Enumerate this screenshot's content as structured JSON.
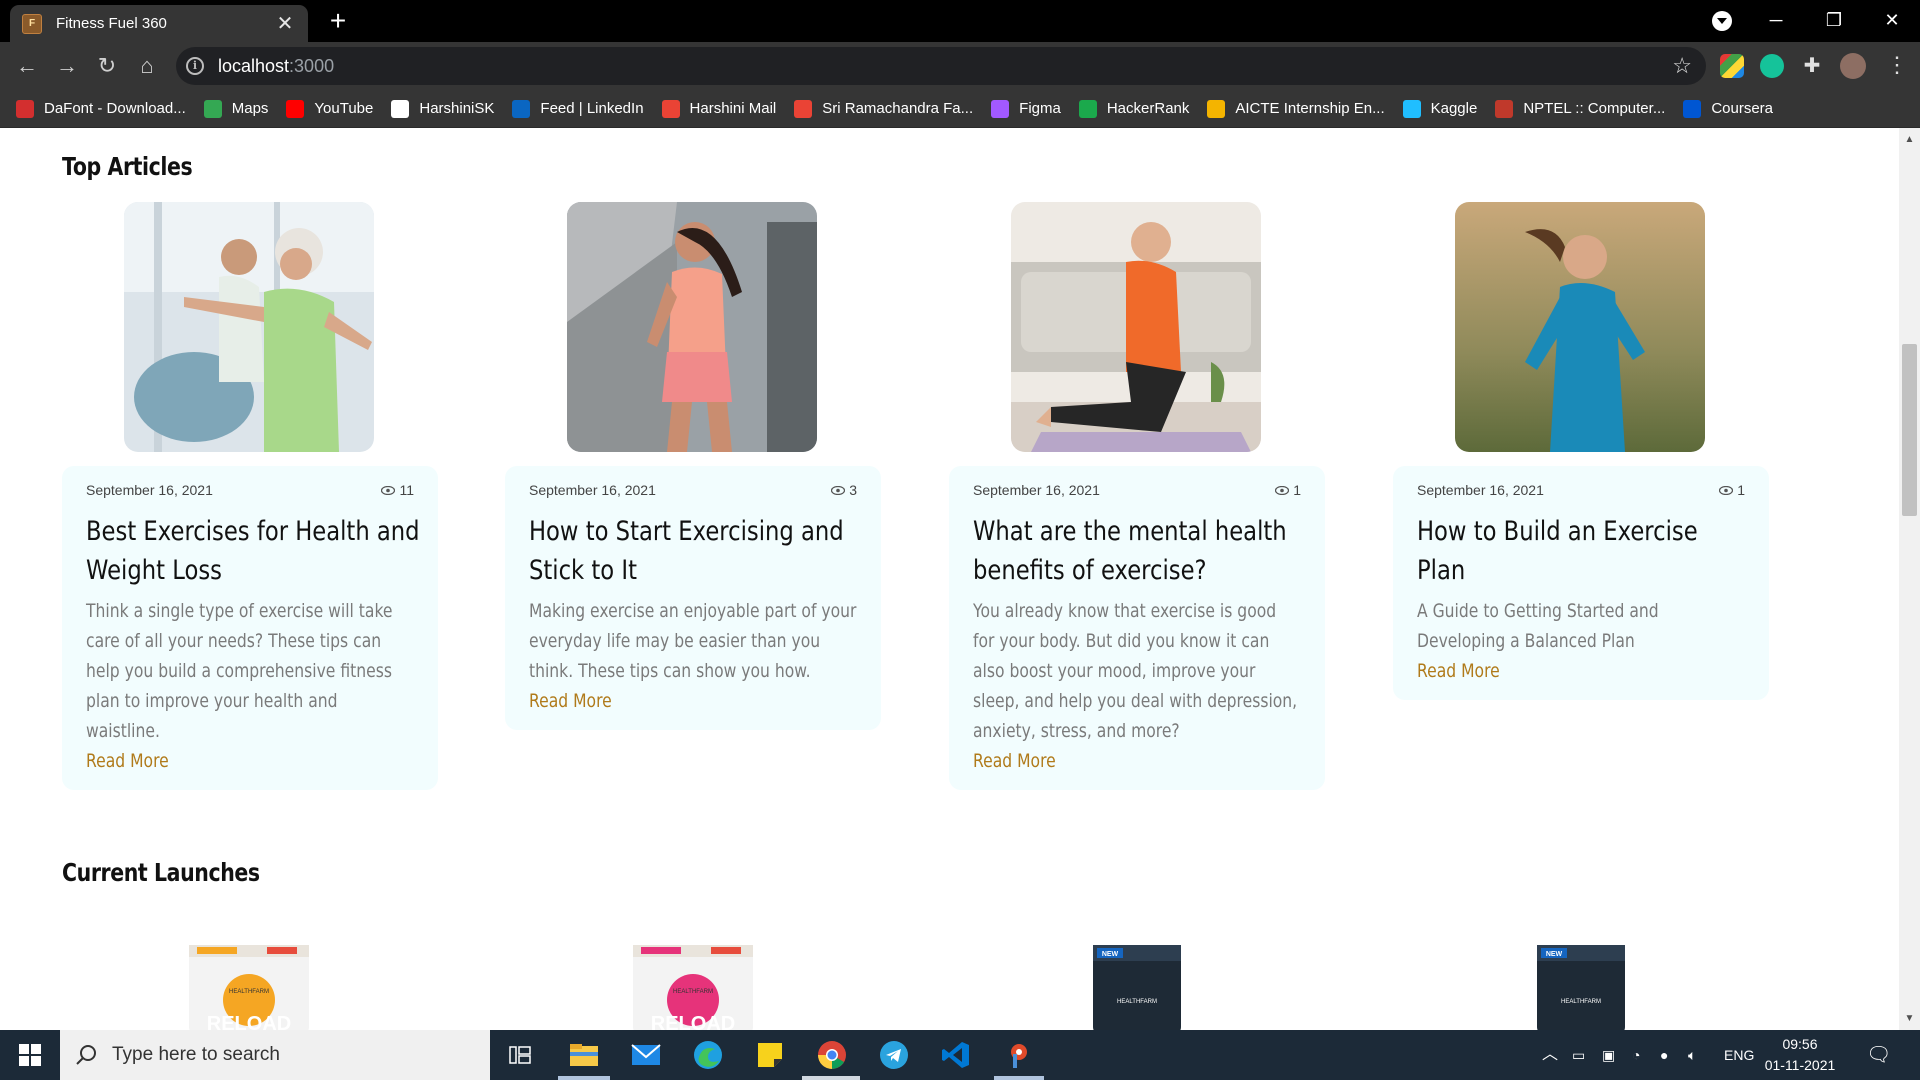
{
  "browser": {
    "tab_title": "Fitness Fuel 360",
    "url_host": "localhost",
    "url_port": ":3000",
    "bookmarks": [
      {
        "label": "DaFont - Download...",
        "icon": "dafont-icon",
        "color": "#d32f2f"
      },
      {
        "label": "Maps",
        "icon": "maps-icon",
        "color": "#34a853"
      },
      {
        "label": "YouTube",
        "icon": "youtube-icon",
        "color": "#ff0000"
      },
      {
        "label": "HarshiniSK",
        "icon": "github-icon",
        "color": "#ffffff"
      },
      {
        "label": "Feed | LinkedIn",
        "icon": "linkedin-icon",
        "color": "#0a66c2"
      },
      {
        "label": "Harshini Mail",
        "icon": "gmail-icon",
        "color": "#ea4335"
      },
      {
        "label": "Sri Ramachandra Fa...",
        "icon": "gmail-icon",
        "color": "#ea4335"
      },
      {
        "label": "Figma",
        "icon": "figma-icon",
        "color": "#a259ff"
      },
      {
        "label": "HackerRank",
        "icon": "hackerrank-icon",
        "color": "#1ba94c"
      },
      {
        "label": "AICTE Internship En...",
        "icon": "aicte-icon",
        "color": "#f4b400"
      },
      {
        "label": "Kaggle",
        "icon": "kaggle-icon",
        "color": "#20beff"
      },
      {
        "label": "NPTEL :: Computer...",
        "icon": "nptel-icon",
        "color": "#c0392b"
      },
      {
        "label": "Coursera",
        "icon": "coursera-icon",
        "color": "#0056d2"
      }
    ]
  },
  "page": {
    "top_articles_title": "Top Articles",
    "current_launches_title": "Current Launches",
    "read_more_label": "Read More",
    "articles": [
      {
        "date": "September 16, 2021",
        "views": "11",
        "title": "Best Exercises for Health and Weight Loss",
        "description": "Think a single type of exercise will take care of all your needs? These tips can help you build a comprehensive fitness plan to improve your health and waistline."
      },
      {
        "date": "September 16, 2021",
        "views": "3",
        "title": "How to Start Exercising and Stick to It",
        "description": "Making exercise an enjoyable part of your everyday life may be easier than you think. These tips can show you how."
      },
      {
        "date": "September 16, 2021",
        "views": "1",
        "title": "What are the mental health benefits of exercise?",
        "description": "You already know that exercise is good for your body. But did you know it can also boost your mood, improve your sleep, and help you deal with depression, anxiety, stress, and more?"
      },
      {
        "date": "September 16, 2021",
        "views": "1",
        "title": "How to Build an Exercise Plan",
        "description": "A Guide to Getting Started and Developing a Balanced Plan"
      }
    ],
    "launches": [
      {
        "brand": "HEALTHFARM",
        "product": "RELOAD",
        "accent": "#f5a623"
      },
      {
        "brand": "HEALTHFARM",
        "product": "RELOAD",
        "accent": "#e6337a"
      },
      {
        "brand": "HEALTHFARM",
        "product": "NEW",
        "accent": "#1565c0"
      },
      {
        "brand": "HEALTHFARM",
        "product": "NEW",
        "accent": "#1565c0"
      }
    ]
  },
  "taskbar": {
    "search_placeholder": "Type here to search",
    "language": "ENG",
    "time": "09:56",
    "date": "01-11-2021"
  }
}
